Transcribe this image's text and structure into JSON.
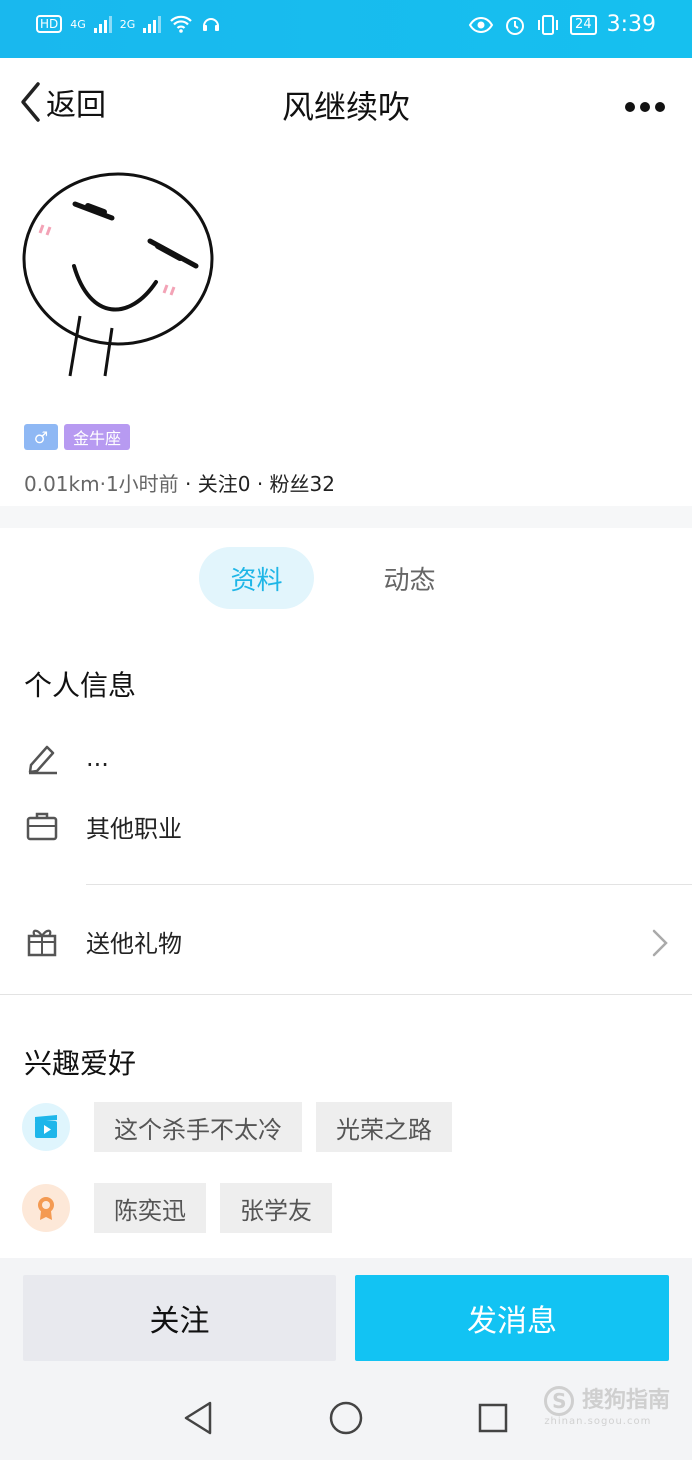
{
  "status": {
    "hd": "HD",
    "sim1": "4G",
    "sim2": "2G",
    "battery": "24",
    "time": "3:39"
  },
  "nav": {
    "back_label": "返回",
    "title": "风继续吹"
  },
  "profile": {
    "gender_symbol": "♂",
    "zodiac": "金牛座",
    "distance": "0.01km·1小时前",
    "stats": "· 关注0 · 粉丝32"
  },
  "tabs": [
    "资料",
    "动态"
  ],
  "personal": {
    "heading": "个人信息",
    "signature": "...",
    "occupation": "其他职业",
    "gift_label": "送他礼物"
  },
  "hobbies": {
    "heading": "兴趣爱好",
    "movies": [
      "这个杀手不太冷",
      "光荣之路"
    ],
    "stars": [
      "陈奕迅",
      "张学友"
    ]
  },
  "actions": {
    "follow_label": "关注",
    "message_label": "发消息"
  },
  "watermark": {
    "brand": "搜狗指南",
    "url": "zhinan.sogou.com"
  },
  "colors": {
    "accent": "#12c3f3",
    "status_bar": "#19b8ee",
    "gender_tag": "#8fb8f4",
    "zodiac_tag": "#b79af1"
  }
}
